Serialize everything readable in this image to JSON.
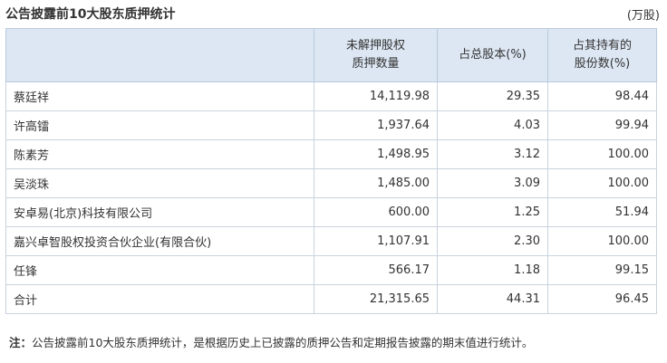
{
  "header": {
    "title": "公告披露前10大股东质押统计",
    "unit": "(万股)"
  },
  "table": {
    "columns": [
      "",
      "未解押股权\n质押数量",
      "占总股本(%)",
      "占其持有的\n股份数(%)"
    ],
    "rows": [
      [
        "蔡廷祥",
        "14,119.98",
        "29.35",
        "98.44"
      ],
      [
        "许高镭",
        "1,937.64",
        "4.03",
        "99.94"
      ],
      [
        "陈素芳",
        "1,498.95",
        "3.12",
        "100.00"
      ],
      [
        "吴淡珠",
        "1,485.00",
        "3.09",
        "100.00"
      ],
      [
        "安卓易(北京)科技有限公司",
        "600.00",
        "1.25",
        "51.94"
      ],
      [
        "嘉兴卓智股权投资合伙企业(有限合伙)",
        "1,107.91",
        "2.30",
        "100.00"
      ],
      [
        "任锋",
        "566.17",
        "1.18",
        "99.15"
      ],
      [
        "合计",
        "21,315.65",
        "44.31",
        "96.45"
      ]
    ]
  },
  "note": {
    "label": "注：",
    "text": "公告披露前10大股东质押统计，是根据历史上已披露的质押公告和定期报告披露的期末值进行统计。"
  },
  "colors": {
    "header_bg": "#dde7f3",
    "border": "#c9d3de",
    "text": "#333333"
  }
}
